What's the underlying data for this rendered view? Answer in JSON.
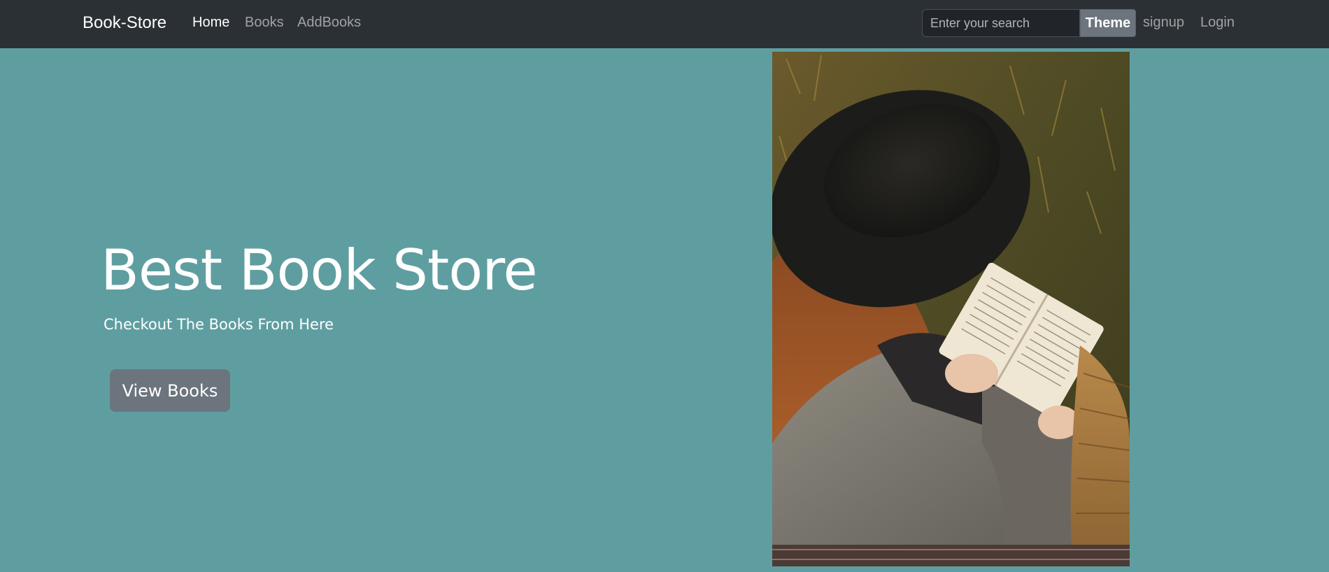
{
  "navbar": {
    "brand": "Book-Store",
    "links": [
      "Home",
      "Books",
      "AddBooks"
    ],
    "search": {
      "placeholder": "Enter your search",
      "value": ""
    },
    "theme_label": "Theme",
    "signup_label": "signup",
    "login_label": "Login"
  },
  "hero": {
    "title": "Best Book Store",
    "subtitle": "Checkout The Books From Here",
    "button_label": "View Books"
  },
  "image": {
    "icon": "photo-woman-reading-book-icon"
  },
  "colors": {
    "page_background": "#5f9ea0",
    "navbar_background": "#2b3035",
    "button_secondary": "#6c757d"
  }
}
